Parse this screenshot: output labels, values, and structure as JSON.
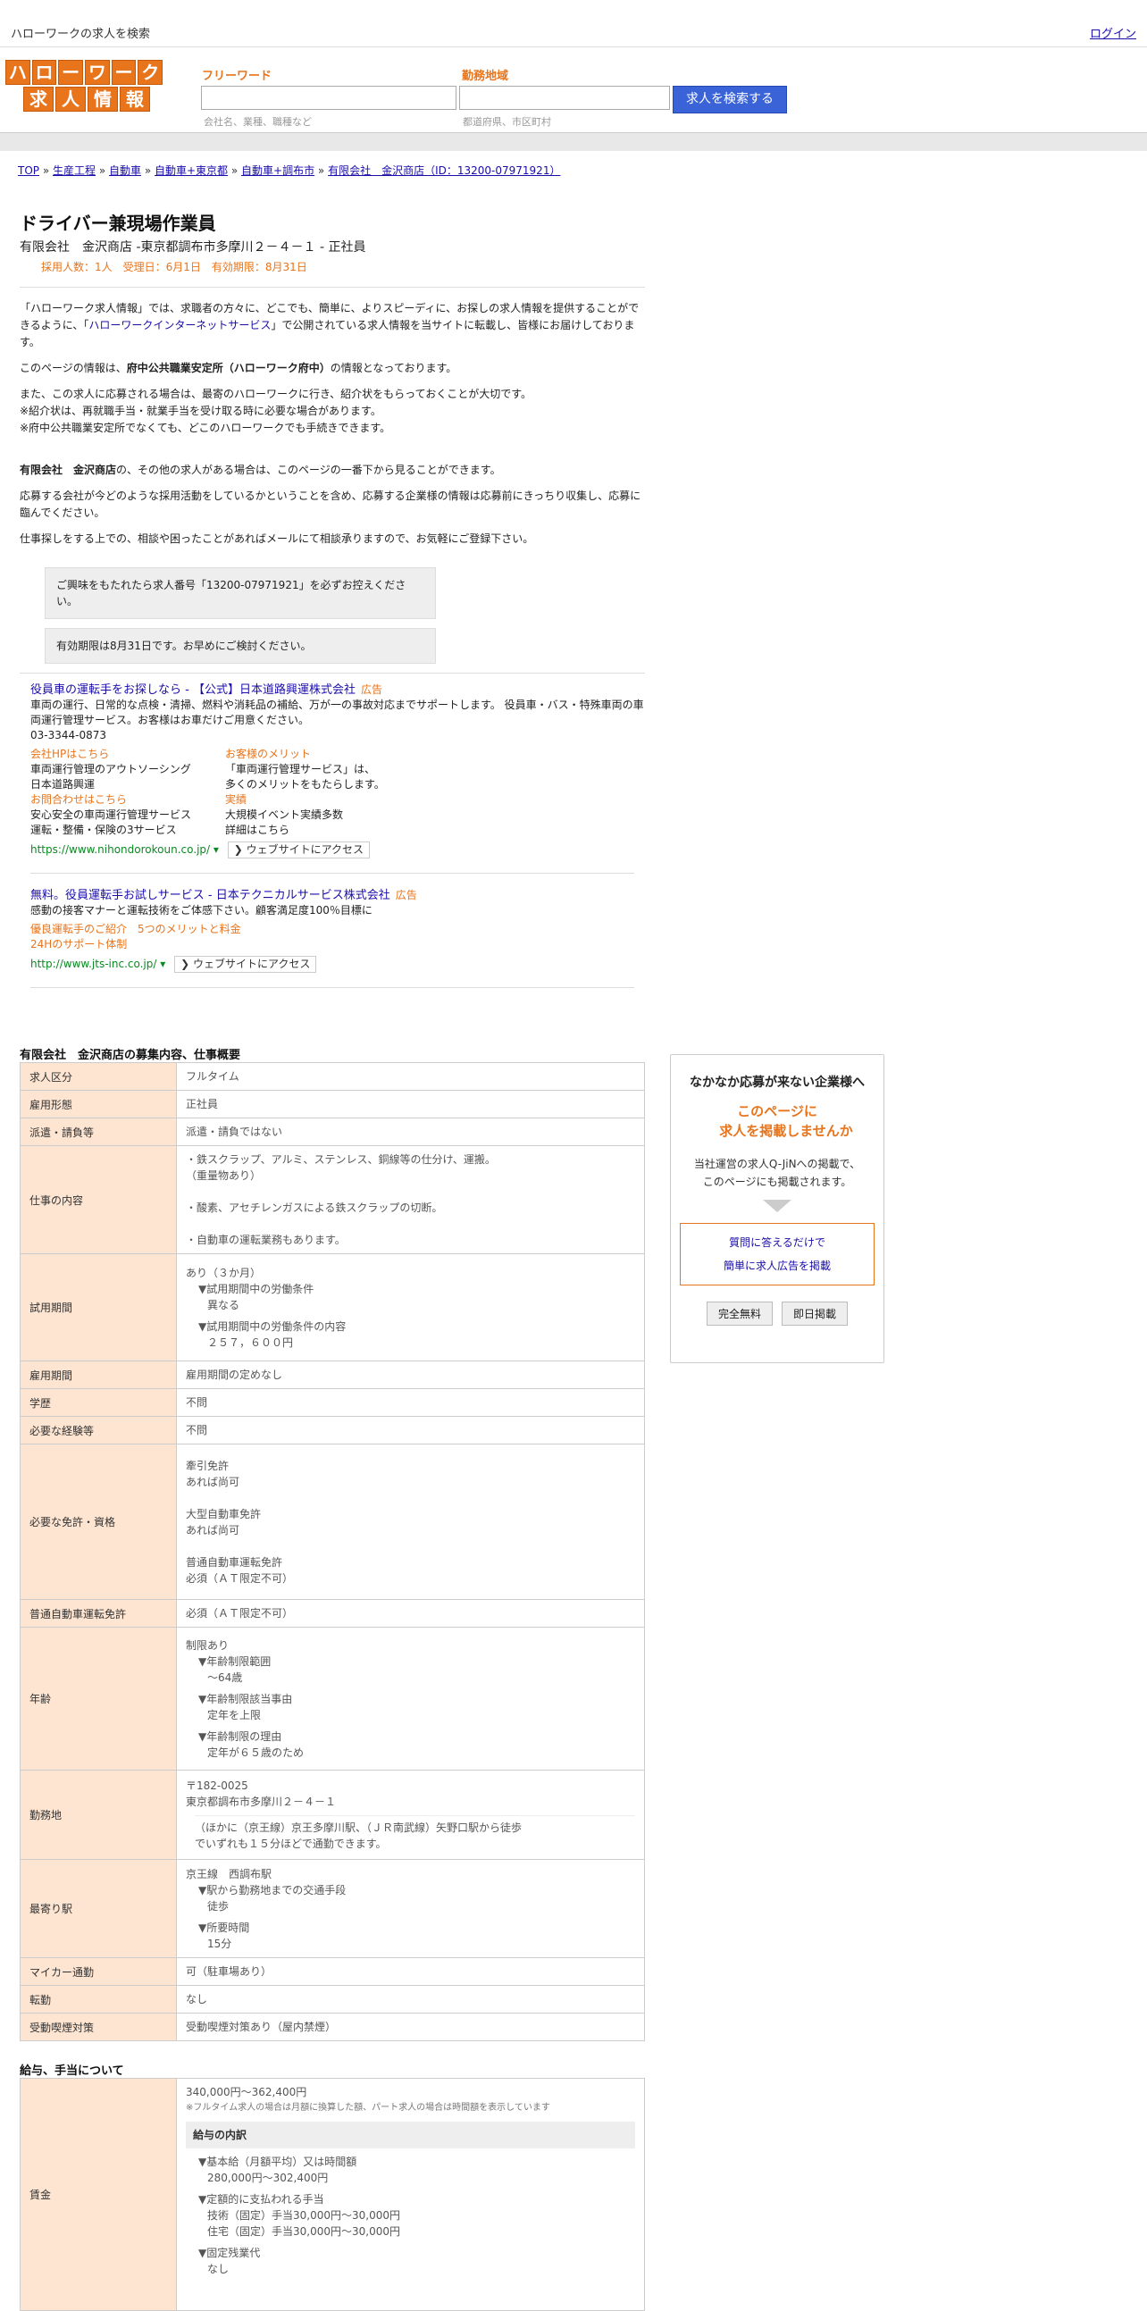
{
  "topbar": {
    "title": "ハローワークの求人を検索",
    "login": "ログイン"
  },
  "logo": {
    "row1": [
      "ハ",
      "ロ",
      "ー",
      "ワ",
      "ー",
      "ク"
    ],
    "row2": [
      "求",
      "人",
      "情",
      "報"
    ]
  },
  "search": {
    "keyword_label": "フリーワード",
    "keyword_hint": "会社名、業種、職種など",
    "keyword_value": "",
    "area_label": "勤務地域",
    "area_hint": "都道府県、市区町村",
    "area_value": "",
    "button": "求人を検索する"
  },
  "breadcrumb": [
    "TOP",
    "生産工程",
    "自動車",
    "自動車+東京都",
    "自動車+調布市",
    "有限会社　金沢商店（ID：13200-07971921）"
  ],
  "job": {
    "title": "ドライバー兼現場作業員",
    "company_line": "有限会社　金沢商店 -東京都調布市多摩川２－４－１ - 正社員",
    "meta": "採用人数：1人　受理日：6月1日　有効期限：8月31日"
  },
  "intro": {
    "p1a": "「ハローワーク求人情報」では、求職者の方々に、どこでも、簡単に、よりスピーディに、お探しの求人情報を提供することができるように、「",
    "p1link": "ハローワークインターネットサービス",
    "p1b": "」で公開されている求人情報を当サイトに転載し、皆様にお届けしております。",
    "p2a": "このページの情報は、",
    "p2b": "府中公共職業安定所（ハローワーク府中）",
    "p2c": "の情報となっております。",
    "p3": "また、この求人に応募される場合は、最寄のハローワークに行き、紹介状をもらっておくことが大切です。",
    "p4": "※紹介状は、再就職手当・就業手当を受け取る時に必要な場合があります。",
    "p5": "※府中公共職業安定所でなくても、どこのハローワークでも手続きできます。",
    "p6a": "有限会社　金沢商店",
    "p6b": "の、その他の求人がある場合は、このページの一番下から見ることができます。",
    "p7": "応募する会社が今どのような採用活動をしているかということを含め、応募する企業様の情報は応募前にきっちり収集し、応募に臨んでください。",
    "p8": "仕事探しをする上での、相談や困ったことがあればメールにて相談承りますので、お気軽にご登録下さい。",
    "notice1": "ご興味をもたれたら求人番号「13200-07971921」を必ずお控えください。",
    "notice2": "有効期限は8月31日です。お早めにご検討ください。"
  },
  "ads": [
    {
      "title": "役員車の運転手をお探しなら - 【公式】日本道路興運株式会社",
      "tag": "広告",
      "desc": "車両の運行、日常的な点検・清掃、燃料や消耗品の補給、万が一の事故対応までサポートします。 役員車・バス・特殊車両の車両運行管理サービス。お客様はお車だけご用意ください。",
      "phone": "03-3344-0873",
      "sub": [
        {
          "k": "会社HPはこちら",
          "v1": "車両運行管理のアウトソーシング",
          "v2": "日本道路興運"
        },
        {
          "k": "お客様のメリット",
          "v1": "「車両運行管理サービス」は、",
          "v2": "多くのメリットをもたらします。"
        },
        {
          "k": "お問合わせはこちら",
          "v1": "安心安全の車両運行管理サービス",
          "v2": "運転・整備・保険の3サービス"
        },
        {
          "k": "実績",
          "v1": "大規模イベント実績多数",
          "v2": "詳細はこちら"
        }
      ],
      "url": "https://www.nihondorokoun.co.jp/",
      "visit": "ウェブサイトにアクセス"
    },
    {
      "title": "無料。役員運転手お試しサービス - 日本テクニカルサービス株式会社",
      "tag": "広告",
      "desc": "感動の接客マナーと運転技術をご体感下さい。顧客満足度100％目標に",
      "links": [
        "優良運転手のご紹介　5つのメリットと料金",
        "24Hのサポート体制"
      ],
      "url": "http://www.jts-inc.co.jp/",
      "visit": "ウェブサイトにアクセス"
    }
  ],
  "overview": {
    "title": "有限会社　金沢商店の募集内容、仕事概要",
    "rows": {
      "r1k": "求人区分",
      "r1v": "フルタイム",
      "r2k": "雇用形態",
      "r2v": "正社員",
      "r3k": "派遣・請負等",
      "r3v": "派遣・請負ではない",
      "r4k": "仕事の内容",
      "r4v1": "・鉄スクラップ、アルミ、ステンレス、銅線等の仕分け、運搬。",
      "r4v2": "（重量物あり）",
      "r4v3": "・酸素、アセチレンガスによる鉄スクラップの切断。",
      "r4v4": "・自動車の運転業務もあります。",
      "r5k": "試用期間",
      "r5v1": "あり（３か月）",
      "r5v2": "▼試用期間中の労働条件",
      "r5v3": "異なる",
      "r5v4": "▼試用期間中の労働条件の内容",
      "r5v5": "２５７，６００円",
      "r6k": "雇用期間",
      "r6v": "雇用期間の定めなし",
      "r7k": "学歴",
      "r7v": "不問",
      "r8k": "必要な経験等",
      "r8v": "不問",
      "r9k": "必要な免許・資格",
      "r9v1": "牽引免許",
      "r9v2": "あれば尚可",
      "r9v3": "大型自動車免許",
      "r9v4": "あれば尚可",
      "r9v5": "普通自動車運転免許",
      "r9v6": "必須（ＡＴ限定不可）",
      "r10k": "普通自動車運転免許",
      "r10v": "必須（ＡＴ限定不可）",
      "r11k": "年齢",
      "r11v1": "制限あり",
      "r11v2": "▼年齢制限範囲",
      "r11v3": "〜64歳",
      "r11v4": "▼年齢制限該当事由",
      "r11v5": "定年を上限",
      "r11v6": "▼年齢制限の理由",
      "r11v7": "定年が６５歳のため",
      "r12k": "勤務地",
      "r12v1": "〒182-0025",
      "r12v2": "東京都調布市多摩川２－４－１",
      "r12v3": "（ほかに（京王線）京王多摩川駅、（ＪＲ南武線）矢野口駅から徒歩",
      "r12v4": "でいずれも１５分ほどで通勤できます。",
      "r13k": "最寄り駅",
      "r13v1": "京王線　西調布駅",
      "r13v2": "▼駅から勤務地までの交通手段",
      "r13v3": "徒歩",
      "r13v4": "▼所要時間",
      "r13v5": "15分",
      "r14k": "マイカー通勤",
      "r14v": "可（駐車場あり）",
      "r15k": "転勤",
      "r15v": "なし",
      "r16k": "受動喫煙対策",
      "r16v": "受動喫煙対策あり（屋内禁煙）"
    }
  },
  "salary": {
    "title": "給与、手当について",
    "key": "賃金",
    "range": "340,000円〜362,400円",
    "note": "※フルタイム求人の場合は月額に換算した額、パート求人の場合は時間額を表示しています",
    "breakdown": "給与の内訳",
    "b1": "▼基本給（月額平均）又は時間額",
    "b2": "280,000円〜302,400円",
    "b3": "▼定額的に支払われる手当",
    "b4": "技術（固定）手当30,000円〜30,000円",
    "b5": "住宅（固定）手当30,000円〜30,000円",
    "b6": "▼固定残業代",
    "b7": "なし"
  },
  "sidebar": {
    "title": "なかなか応募が来ない企業様へ",
    "sub1": "このページに",
    "sub2": "求人を掲載しませんか",
    "desc1": "当社運営の求人Q-JiNへの掲載で、",
    "desc2": "このページにも掲載されます。",
    "link1": "質問に答えるだけで",
    "link2": "簡単に求人広告を掲載",
    "btn1": "完全無料",
    "btn2": "即日掲載"
  }
}
